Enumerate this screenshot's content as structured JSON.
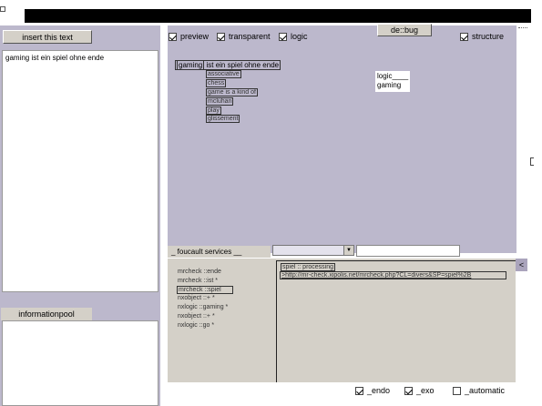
{
  "left": {
    "insert_button": "insert this text",
    "text_value": "gaming ist ein spiel ohne ende",
    "infopool_label": "informationpool"
  },
  "toolbar": {
    "preview": "preview",
    "transparent": "transparent",
    "logic": "logic",
    "debug_button": "de::bug",
    "structure": "structure"
  },
  "canvas": {
    "root_word": "gaming",
    "root_rest": "ist ein spiel ohne ende",
    "children": [
      "associative",
      "chess",
      "game is a kind of",
      "mcluhan",
      "play",
      "glissement"
    ],
    "logic_label": "logic____",
    "logic_value": "gaming"
  },
  "services": {
    "label": "_ foucault services __",
    "select_value": "",
    "input_value": "",
    "collapse_glyph": "<",
    "list": [
      "mrcheck ::ende",
      "mrcheck ::ist *",
      "mrcheck ::spiel",
      "nxobject ::+ *",
      "nxlogic ::gaming *",
      "nxobject ::+ *",
      "nxlogic ::go *"
    ],
    "processing": "spiel :: processing",
    "url": ">http://mr-check.xipolis.net/mrcheck.php?CL=divers&SP=spiel%2B"
  },
  "bottom": {
    "endo": "_endo",
    "exo": "_exo",
    "automatic": "_automatic"
  }
}
